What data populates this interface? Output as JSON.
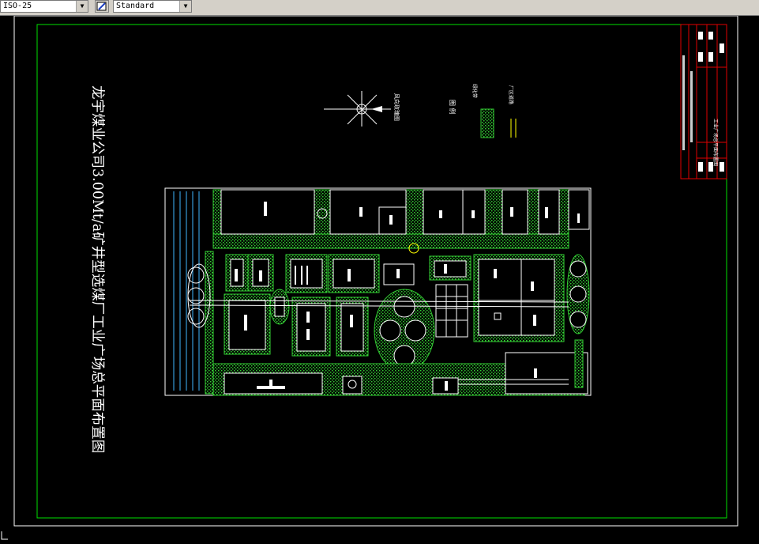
{
  "toolbar": {
    "dimstyle_value": "ISO-25",
    "textstyle_value": "Standard"
  },
  "drawing": {
    "title_text": "龙宇煤业公司3.00Mt/a矿井型选煤厂工业广场总平面布置图",
    "legend_header": "图 例",
    "legend_items": [
      "绿化带",
      "厂区道路"
    ],
    "compass_label": "风向玫瑰图",
    "titleblock_name": "工业广场总平面布置图"
  },
  "colors": {
    "green_frame": "#00e000",
    "red_frame": "#e00000",
    "white": "#ffffff",
    "hatch": "#33cc33"
  }
}
